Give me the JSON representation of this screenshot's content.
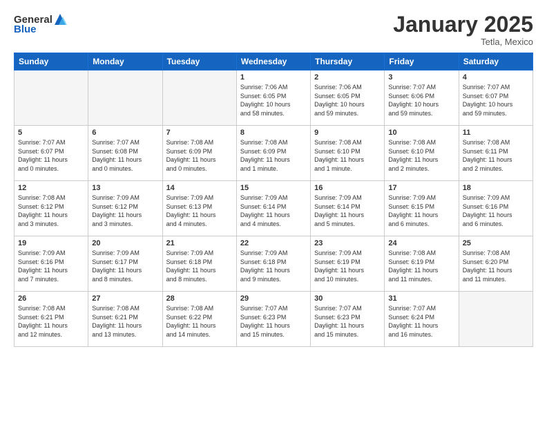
{
  "header": {
    "logo_general": "General",
    "logo_blue": "Blue",
    "month_title": "January 2025",
    "location": "Tetla, Mexico"
  },
  "days_of_week": [
    "Sunday",
    "Monday",
    "Tuesday",
    "Wednesday",
    "Thursday",
    "Friday",
    "Saturday"
  ],
  "weeks": [
    [
      {
        "day": "",
        "info": ""
      },
      {
        "day": "",
        "info": ""
      },
      {
        "day": "",
        "info": ""
      },
      {
        "day": "1",
        "info": "Sunrise: 7:06 AM\nSunset: 6:05 PM\nDaylight: 10 hours\nand 58 minutes."
      },
      {
        "day": "2",
        "info": "Sunrise: 7:06 AM\nSunset: 6:05 PM\nDaylight: 10 hours\nand 59 minutes."
      },
      {
        "day": "3",
        "info": "Sunrise: 7:07 AM\nSunset: 6:06 PM\nDaylight: 10 hours\nand 59 minutes."
      },
      {
        "day": "4",
        "info": "Sunrise: 7:07 AM\nSunset: 6:07 PM\nDaylight: 10 hours\nand 59 minutes."
      }
    ],
    [
      {
        "day": "5",
        "info": "Sunrise: 7:07 AM\nSunset: 6:07 PM\nDaylight: 11 hours\nand 0 minutes."
      },
      {
        "day": "6",
        "info": "Sunrise: 7:07 AM\nSunset: 6:08 PM\nDaylight: 11 hours\nand 0 minutes."
      },
      {
        "day": "7",
        "info": "Sunrise: 7:08 AM\nSunset: 6:09 PM\nDaylight: 11 hours\nand 0 minutes."
      },
      {
        "day": "8",
        "info": "Sunrise: 7:08 AM\nSunset: 6:09 PM\nDaylight: 11 hours\nand 1 minute."
      },
      {
        "day": "9",
        "info": "Sunrise: 7:08 AM\nSunset: 6:10 PM\nDaylight: 11 hours\nand 1 minute."
      },
      {
        "day": "10",
        "info": "Sunrise: 7:08 AM\nSunset: 6:10 PM\nDaylight: 11 hours\nand 2 minutes."
      },
      {
        "day": "11",
        "info": "Sunrise: 7:08 AM\nSunset: 6:11 PM\nDaylight: 11 hours\nand 2 minutes."
      }
    ],
    [
      {
        "day": "12",
        "info": "Sunrise: 7:08 AM\nSunset: 6:12 PM\nDaylight: 11 hours\nand 3 minutes."
      },
      {
        "day": "13",
        "info": "Sunrise: 7:09 AM\nSunset: 6:12 PM\nDaylight: 11 hours\nand 3 minutes."
      },
      {
        "day": "14",
        "info": "Sunrise: 7:09 AM\nSunset: 6:13 PM\nDaylight: 11 hours\nand 4 minutes."
      },
      {
        "day": "15",
        "info": "Sunrise: 7:09 AM\nSunset: 6:14 PM\nDaylight: 11 hours\nand 4 minutes."
      },
      {
        "day": "16",
        "info": "Sunrise: 7:09 AM\nSunset: 6:14 PM\nDaylight: 11 hours\nand 5 minutes."
      },
      {
        "day": "17",
        "info": "Sunrise: 7:09 AM\nSunset: 6:15 PM\nDaylight: 11 hours\nand 6 minutes."
      },
      {
        "day": "18",
        "info": "Sunrise: 7:09 AM\nSunset: 6:16 PM\nDaylight: 11 hours\nand 6 minutes."
      }
    ],
    [
      {
        "day": "19",
        "info": "Sunrise: 7:09 AM\nSunset: 6:16 PM\nDaylight: 11 hours\nand 7 minutes."
      },
      {
        "day": "20",
        "info": "Sunrise: 7:09 AM\nSunset: 6:17 PM\nDaylight: 11 hours\nand 8 minutes."
      },
      {
        "day": "21",
        "info": "Sunrise: 7:09 AM\nSunset: 6:18 PM\nDaylight: 11 hours\nand 8 minutes."
      },
      {
        "day": "22",
        "info": "Sunrise: 7:09 AM\nSunset: 6:18 PM\nDaylight: 11 hours\nand 9 minutes."
      },
      {
        "day": "23",
        "info": "Sunrise: 7:09 AM\nSunset: 6:19 PM\nDaylight: 11 hours\nand 10 minutes."
      },
      {
        "day": "24",
        "info": "Sunrise: 7:08 AM\nSunset: 6:19 PM\nDaylight: 11 hours\nand 11 minutes."
      },
      {
        "day": "25",
        "info": "Sunrise: 7:08 AM\nSunset: 6:20 PM\nDaylight: 11 hours\nand 11 minutes."
      }
    ],
    [
      {
        "day": "26",
        "info": "Sunrise: 7:08 AM\nSunset: 6:21 PM\nDaylight: 11 hours\nand 12 minutes."
      },
      {
        "day": "27",
        "info": "Sunrise: 7:08 AM\nSunset: 6:21 PM\nDaylight: 11 hours\nand 13 minutes."
      },
      {
        "day": "28",
        "info": "Sunrise: 7:08 AM\nSunset: 6:22 PM\nDaylight: 11 hours\nand 14 minutes."
      },
      {
        "day": "29",
        "info": "Sunrise: 7:07 AM\nSunset: 6:23 PM\nDaylight: 11 hours\nand 15 minutes."
      },
      {
        "day": "30",
        "info": "Sunrise: 7:07 AM\nSunset: 6:23 PM\nDaylight: 11 hours\nand 15 minutes."
      },
      {
        "day": "31",
        "info": "Sunrise: 7:07 AM\nSunset: 6:24 PM\nDaylight: 11 hours\nand 16 minutes."
      },
      {
        "day": "",
        "info": ""
      }
    ]
  ]
}
